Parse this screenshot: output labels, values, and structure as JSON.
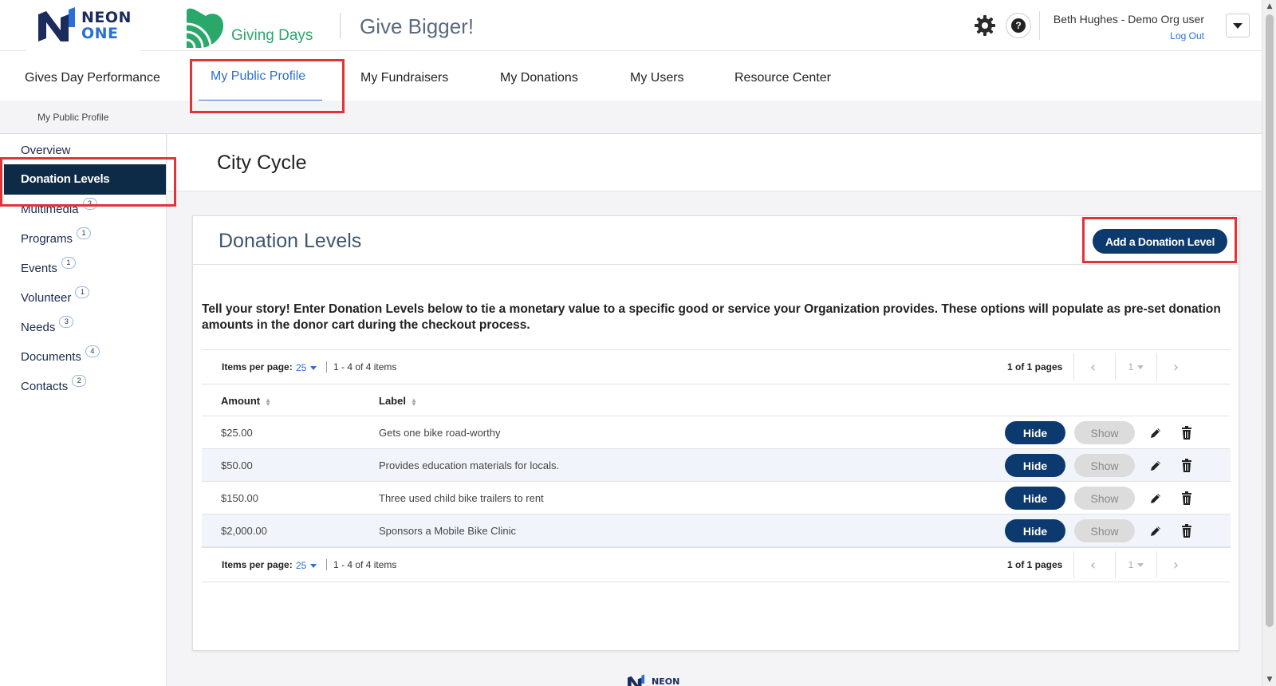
{
  "header": {
    "brand_neon_line1": "NEON",
    "brand_neon_line2": "ONE",
    "brand_giving": "Giving Days",
    "tagline": "Give Bigger!",
    "help_glyph": "?",
    "user_name": "Beth Hughes - Demo Org user",
    "logout": "Log Out",
    "icons": [
      "gear-icon",
      "help-icon",
      "caret-down-icon"
    ]
  },
  "nav": {
    "items": [
      {
        "label": "Gives Day Performance",
        "active": false
      },
      {
        "label": "My Public Profile",
        "active": true
      },
      {
        "label": "My Fundraisers",
        "active": false
      },
      {
        "label": "My Donations",
        "active": false
      },
      {
        "label": "My Users",
        "active": false
      },
      {
        "label": "Resource Center",
        "active": false
      }
    ],
    "accent_color": "#2a6fd6"
  },
  "breadcrumb": "My Public Profile",
  "sidebar": {
    "items": [
      {
        "label": "Overview",
        "count": ""
      },
      {
        "label": "Donation Levels",
        "count": "",
        "active": true
      },
      {
        "label": "Multimedia",
        "count": "3"
      },
      {
        "label": "Programs",
        "count": "1"
      },
      {
        "label": "Events",
        "count": "1"
      },
      {
        "label": "Volunteer",
        "count": "1"
      },
      {
        "label": "Needs",
        "count": "3"
      },
      {
        "label": "Documents",
        "count": "4"
      },
      {
        "label": "Contacts",
        "count": "2"
      }
    ],
    "active_color": "#0d2a47"
  },
  "page": {
    "title": "City Cycle"
  },
  "card": {
    "title": "Donation Levels",
    "add_button": "Add a Donation Level",
    "intro": "Tell your story! Enter Donation Levels below to tie a monetary value to a specific good or service your Organization provides. These options will populate as pre-set donation amounts in the donor cart during the checkout process."
  },
  "grid": {
    "pager": {
      "items_per_page_label": "Items per page:",
      "items_per_page": "25",
      "range": "1 - 4 of 4 items",
      "pages": "1 of 1 pages",
      "page_select": "1",
      "prev_glyph": "‹",
      "next_glyph": "›"
    },
    "columns": [
      "Amount",
      "Label"
    ],
    "rows": [
      {
        "amount": "$25.00",
        "label": "Gets one bike road-worthy"
      },
      {
        "amount": "$50.00",
        "label": "Provides education materials for locals."
      },
      {
        "amount": "$150.00",
        "label": "Three used child bike trailers to rent"
      },
      {
        "amount": "$2,000.00",
        "label": "Sponsors a Mobile Bike Clinic"
      }
    ],
    "hide_label": "Hide",
    "show_label": "Show",
    "primary_color": "#0d3a6e"
  },
  "footer": {
    "brand": "NEON"
  }
}
